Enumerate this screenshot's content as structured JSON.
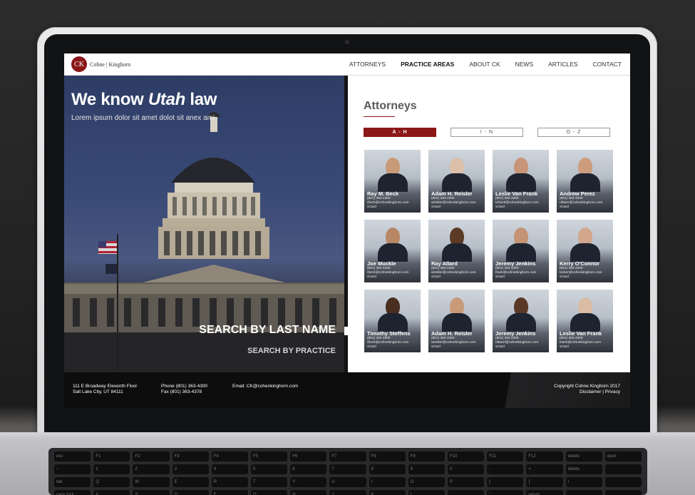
{
  "logo": {
    "monogram": "CK",
    "name": "Cohne | Kinghorn"
  },
  "nav": {
    "items": [
      "ATTORNEYS",
      "PRACTICE AREAS",
      "ABOUT CK",
      "NEWS",
      "ARTICLES",
      "CONTACT"
    ]
  },
  "hero": {
    "title_prefix": "We know ",
    "title_emph": "Utah",
    "title_suffix": " law",
    "subtitle": "Lorem ipsum dolor sit amet dolot sit anex ami",
    "search_last_name": "SEARCH BY LAST NAME",
    "search_practice": "SEARCH BY PRACTICE"
  },
  "panel": {
    "title": "Attorneys",
    "tabs": [
      "A - H",
      "I - N",
      "O - Z"
    ],
    "attorneys": [
      {
        "name": "Ray M. Beck",
        "phone": "(801) 363 4300",
        "email": "rbeck@cohnekinghorn.com",
        "vcard": "vCard",
        "skin": "#c99a78"
      },
      {
        "name": "Adam H. Reisler",
        "phone": "(801) 363 4300",
        "email": "areisler@cohnekinghorn.com",
        "vcard": "vCard",
        "skin": "#dcbfa8"
      },
      {
        "name": "Leslie Van Frank",
        "phone": "(801) 363 4300",
        "email": "lvfrank@cohnekinghorn.com",
        "vcard": "vCard",
        "skin": "#c8957a"
      },
      {
        "name": "Andrew Perez",
        "phone": "(801) 363 4300",
        "email": "rsbare@cohnekinghorn.com",
        "vcard": "vCard",
        "skin": "#cc9c7c"
      },
      {
        "name": "Joe Muckle",
        "phone": "(801) 363 4300",
        "email": "rbeck@cohnekinghorn.com",
        "vcard": "vCard",
        "skin": "#b88766"
      },
      {
        "name": "Ray Allard",
        "phone": "(801) 363 4300",
        "email": "areisler@cohnekinghorn.com",
        "vcard": "vCard",
        "skin": "#5c3a26"
      },
      {
        "name": "Jeremy Jenkins",
        "phone": "(801) 363 4300",
        "email": "frank@cohnekinghorn.com",
        "vcard": "vCard",
        "skin": "#c49474"
      },
      {
        "name": "Kerry O'Connor",
        "phone": "(801) 363 4300",
        "email": "lecker@cohnekinghorn.com",
        "vcard": "vCard",
        "skin": "#d2a68a"
      },
      {
        "name": "Timothy Steffens",
        "phone": "(801) 363 4300",
        "email": "rbeck@cohnekinghorn.com",
        "vcard": "vCard",
        "skin": "#4a2e1f"
      },
      {
        "name": "Adam H. Reisler",
        "phone": "(801) 363 4300",
        "email": "areisler@cohnekinghorn.com",
        "vcard": "vCard",
        "skin": "#c99a78"
      },
      {
        "name": "Jeremy Jenkins",
        "phone": "(801) 363 4300",
        "email": "rsbare@cohnekinghorn.com",
        "vcard": "vCard",
        "skin": "#5a3826"
      },
      {
        "name": "Leslie Van Frank",
        "phone": "(801) 363 4300",
        "email": "lvanh@cohnekinghorn.com",
        "vcard": "vCard",
        "skin": "#dbbca4"
      }
    ]
  },
  "footer": {
    "address_line1": "111 E Broadway Eleventh Floor",
    "address_line2": "Salt Lake City, UT 84111",
    "phone": "Phone (801) 363-4300",
    "fax": "Fax (801) 363-4378",
    "email": "Email: CK@cohenkinghorn.com",
    "copyright": "Copyright Cohne Kinghorn 2017",
    "links": "Disclaimer | Privacy"
  },
  "colors": {
    "brand_red": "#8a1818",
    "footer_bg": "#0d0d0e",
    "hero_sky": "#394a76"
  },
  "keyboard": [
    "esc",
    "F1",
    "F2",
    "F3",
    "F4",
    "F5",
    "F6",
    "F7",
    "F8",
    "F9",
    "F10",
    "F11",
    "F12",
    "delete",
    "eject",
    "~",
    "1",
    "2",
    "3",
    "4",
    "5",
    "6",
    "7",
    "8",
    "9",
    "0",
    "-",
    "=",
    "delete",
    "",
    "tab",
    "Q",
    "W",
    "E",
    "R",
    "T",
    "Y",
    "U",
    "I",
    "O",
    "P",
    "[",
    "]",
    "\\",
    "",
    "caps lock",
    "A",
    "S",
    "D",
    "F",
    "G",
    "H",
    "J",
    "K",
    "L",
    ";",
    "'",
    "return",
    "",
    ""
  ]
}
